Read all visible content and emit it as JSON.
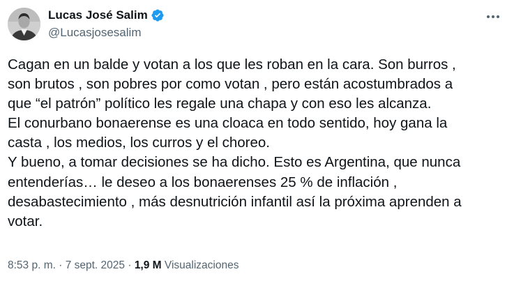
{
  "author": {
    "display_name": "Lucas José Salim",
    "handle": "@Lucasjosesalim",
    "verified": true
  },
  "tweet": {
    "lines": [
      "Cagan en un balde y votan a los que les roban en la cara. Son burros ,",
      "son brutos , son pobres por como votan , pero están acostumbrados a",
      "que “el patrón” político les regale una chapa y con eso les alcanza.",
      "El conurbano bonaerense es una cloaca en todo sentido, hoy gana la",
      "casta , los medios, los curros y el choreo.",
      "Y bueno, a tomar decisiones se ha dicho. Esto es Argentina, que nunca",
      "entenderías… le deseo a los bonaerenses 25 % de inflación ,",
      "desabastecimiento , más desnutrición infantil así la próxima aprenden a",
      "votar."
    ]
  },
  "meta": {
    "timestamp": "8:53 p. m. · 7 sept. 2025",
    "separator": " · ",
    "views_count": "1,9 M",
    "views_label": "Visualizaciones"
  },
  "colors": {
    "text": "#0f1419",
    "secondary": "#536471",
    "verified_blue": "#1d9bf0"
  },
  "icons": {
    "verified": "verified-badge-icon",
    "more": "more-options-icon"
  }
}
